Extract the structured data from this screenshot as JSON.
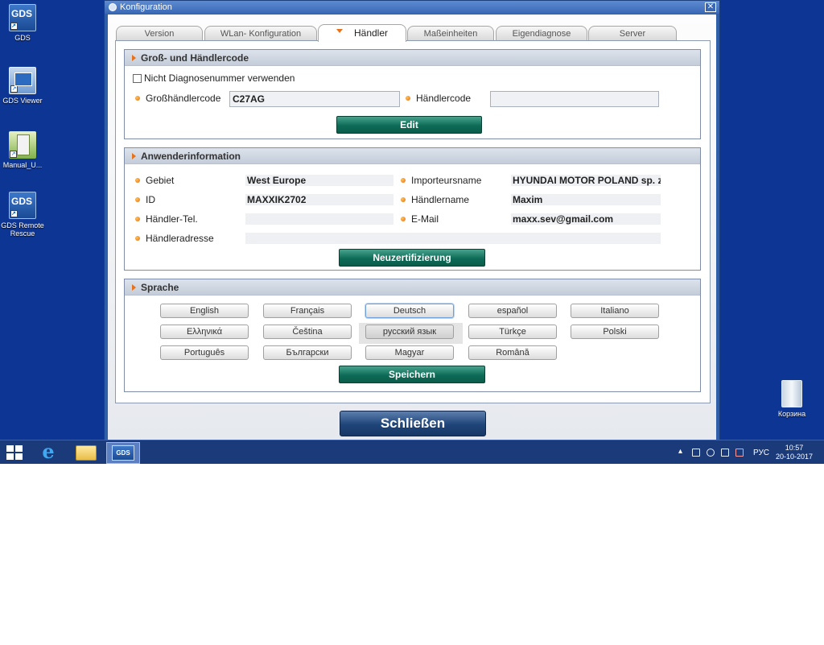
{
  "desktop": {
    "icons": [
      {
        "label": "GDS",
        "badge": "GDS"
      },
      {
        "label": "GDS Viewer"
      },
      {
        "label": "Manual_U..."
      },
      {
        "label": "GDS Remote Rescue",
        "badge": "GDS"
      },
      {
        "label": "Корзина"
      }
    ]
  },
  "window": {
    "title": "Konfiguration",
    "close_glyph": "✕",
    "tabs": [
      {
        "label": "Version"
      },
      {
        "label": "WLan- Konfiguration"
      },
      {
        "label": "Händler"
      },
      {
        "label": "Maßeinheiten"
      },
      {
        "label": "Eigendiagnose"
      },
      {
        "label": "Server"
      }
    ],
    "dealer_code": {
      "heading": "Groß- und Händlercode",
      "no_diag_label": "Nicht Diagnosenummer verwenden",
      "no_diag_checked": false,
      "wholesale_label": "Großhändlercode",
      "wholesale_value": "C27AG",
      "dealer_label": "Händlercode",
      "dealer_value": "",
      "edit_button": "Edit"
    },
    "user_info": {
      "heading": "Anwenderinformation",
      "area_label": "Gebiet",
      "area_value": "West Europe",
      "id_label": "ID",
      "id_value": "MAXXIK2702",
      "phone_label": "Händler-Tel.",
      "phone_value": "",
      "address_label": "Händleradresse",
      "address_value": "",
      "importer_label": "Importeursname",
      "importer_value": "HYUNDAI MOTOR POLAND sp. z",
      "dealer_name_label": "Händlername",
      "dealer_name_value": "Maxim",
      "email_label": "E-Mail",
      "email_value": "maxx.sev@gmail.com",
      "recert_button": "Neuzertifizierung"
    },
    "language": {
      "heading": "Sprache",
      "options": [
        "English",
        "Français",
        "Deutsch",
        "español",
        "Italiano",
        "Ελληνικά",
        "Čeština",
        "русский язык",
        "Türkçe",
        "Polski",
        "Português",
        "Български",
        "Magyar",
        "Română"
      ],
      "save_button": "Speichern"
    },
    "close_button": "Schließen"
  },
  "taskbar": {
    "gds_label": "GDS",
    "language_indicator": "РУС",
    "time": "10:57",
    "date": "20-10-2017",
    "tray_arrow": "▴"
  }
}
